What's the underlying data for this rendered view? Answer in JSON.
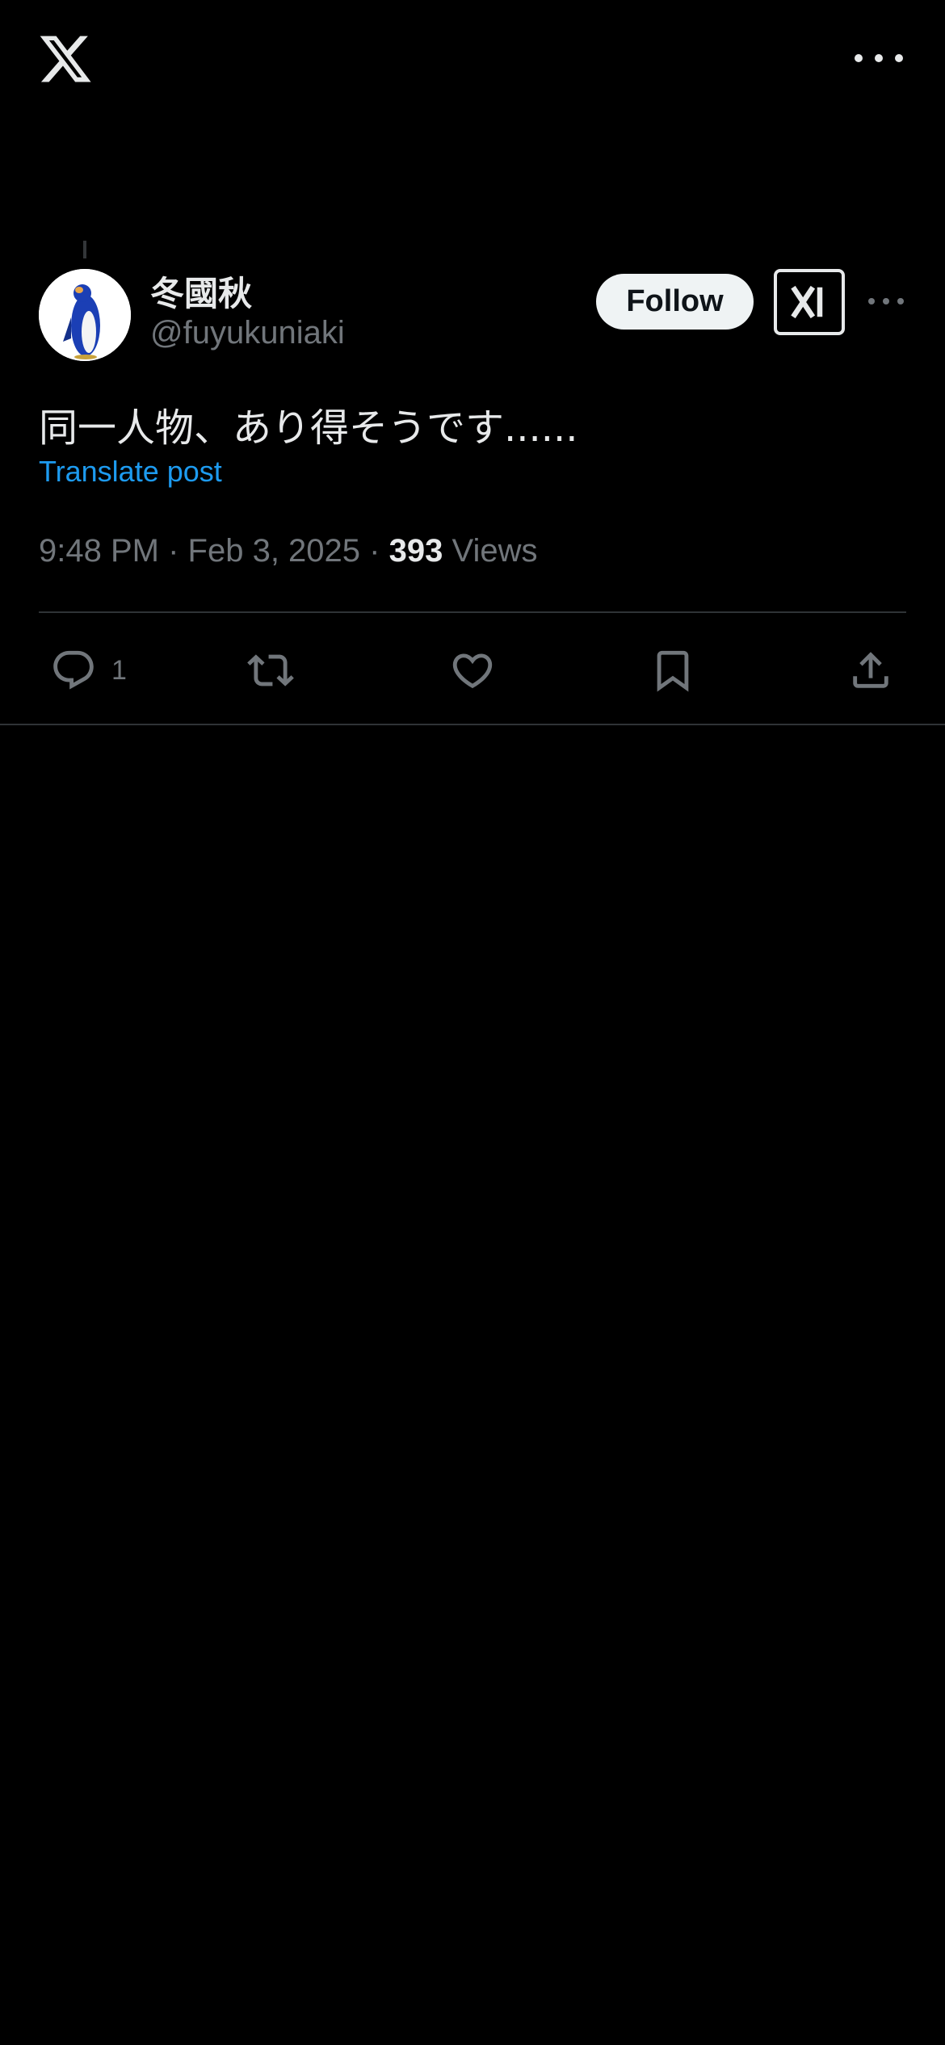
{
  "app": {
    "logo_icon": "x-logo-icon",
    "menu_icon": "more-horizontal-icon"
  },
  "post": {
    "author": {
      "display_name": "冬國秋",
      "handle": "@fuyukuniaki",
      "avatar": "penguin-avatar"
    },
    "follow_label": "Follow",
    "grok_icon": "grok-icon",
    "more_icon": "more-horizontal-icon",
    "text": "同一人物、あり得そうです......",
    "translate_label": "Translate post",
    "time": "9:48 PM",
    "separator": "·",
    "date": "Feb 3, 2025",
    "views_count": "393",
    "views_label": "Views",
    "actions": {
      "reply_count": "1",
      "reply_icon": "reply-icon",
      "repost_icon": "repost-icon",
      "like_icon": "heart-icon",
      "bookmark_icon": "bookmark-icon",
      "share_icon": "share-icon"
    }
  },
  "colors": {
    "background": "#000000",
    "text_primary": "#e7e9ea",
    "text_secondary": "#71767b",
    "link": "#1d9bf0",
    "divider": "#2f3336",
    "follow_bg": "#eff3f4"
  }
}
